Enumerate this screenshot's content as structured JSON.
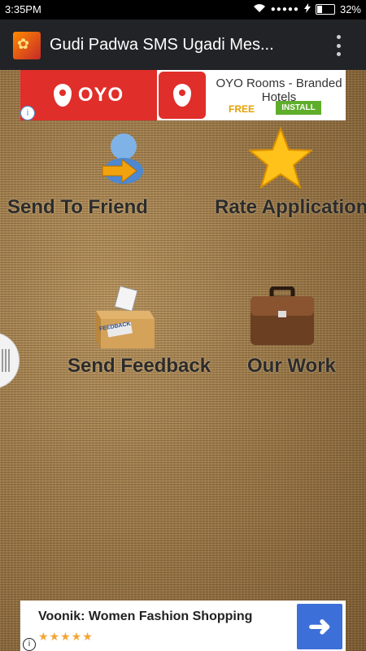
{
  "status": {
    "time": "3:35PM",
    "battery": "32%"
  },
  "appbar": {
    "title": "Gudi Padwa SMS Ugadi Mes..."
  },
  "top_ad": {
    "brand": "OYO",
    "title": "OYO Rooms - Branded Hotels",
    "free": "FREE",
    "install": "INSTALL",
    "info": "i"
  },
  "menu": {
    "send_to_friend": "Send To Friend",
    "rate_application": "Rate Application",
    "send_feedback": "Send Feedback",
    "our_work": "Our Work",
    "feedback_box_text": "FEEDBACK"
  },
  "bottom_ad": {
    "title": "Voonik: Women Fashion Shopping",
    "rating": 4.5,
    "stars": "★★★★★",
    "info": "i"
  },
  "colors": {
    "appbar": "#222326",
    "oyo_red": "#e02e2a",
    "install_green": "#5fae2b",
    "arrow_blue": "#3d6fd8"
  }
}
